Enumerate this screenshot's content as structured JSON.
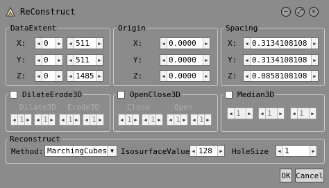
{
  "window": {
    "title": "ReConstruct"
  },
  "titlebar": {
    "minimize_glyph": "–",
    "restore_glyph": "⤢",
    "close_glyph": "✕"
  },
  "data_extent": {
    "label": "DataExtent",
    "x_label": "X:",
    "y_label": "Y:",
    "z_label": "Z:",
    "x": [
      "0",
      "511"
    ],
    "y": [
      "0",
      "511"
    ],
    "z": [
      "0",
      "1485"
    ]
  },
  "origin": {
    "label": "Origin",
    "x_label": "X:",
    "y_label": "Y:",
    "z_label": "Z:",
    "x": "0.0000",
    "y": "0.0000",
    "z": "0.0000"
  },
  "spacing": {
    "label": "Spacing",
    "x_label": "X:",
    "y_label": "Y:",
    "z_label": "Z:",
    "x": "0.3134108108",
    "y": "0.3134108108",
    "z": "0.0858108108"
  },
  "dilate_erode": {
    "label": "DilateErode3D",
    "checked": false,
    "dilate_label": "Dilate3D",
    "erode_label": "Erode3D",
    "dilate": [
      "1",
      "1"
    ],
    "erode": [
      "1",
      "1"
    ]
  },
  "open_close": {
    "label": "OpenClose3D",
    "checked": false,
    "close_label": "Close",
    "open_label": "Open",
    "close": [
      "1",
      "1"
    ],
    "open": [
      "1",
      "1"
    ]
  },
  "median": {
    "label": "Median3D",
    "checked": false,
    "values": [
      "1",
      "1",
      "1"
    ]
  },
  "reconstruct": {
    "label": "Reconstruct",
    "method_label": "Method:",
    "method_value": "MarchingCubes",
    "isosurface_label": "IsosurfaceValue",
    "isosurface_value": "128",
    "hole_label": "HoleSize",
    "hole_value": "1"
  },
  "buttons": {
    "ok": "OK",
    "cancel": "Cancel"
  },
  "arrows": {
    "left": "◀",
    "right": "▶",
    "down": "▼"
  }
}
